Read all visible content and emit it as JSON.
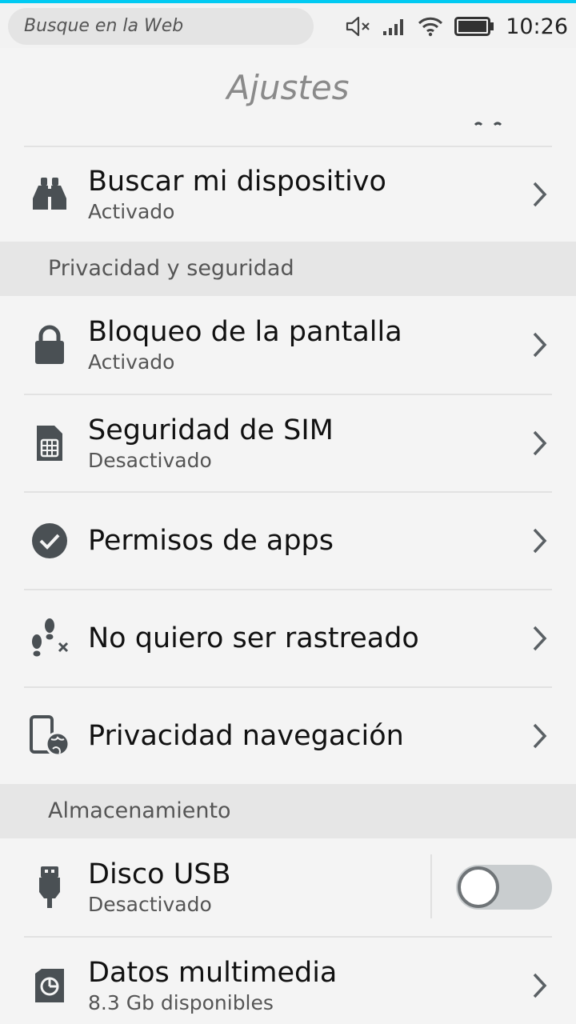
{
  "status_bar": {
    "search_placeholder": "Busque en la Web",
    "time": "10:26",
    "icons": [
      "mute-icon",
      "signal-icon",
      "wifi-icon",
      "battery-icon"
    ]
  },
  "header": {
    "title": "Ajustes"
  },
  "rows_top": [
    {
      "label": "Buscar mi dispositivo",
      "sub": "Activado",
      "icon": "binoculars-icon"
    }
  ],
  "sections": {
    "privacy": "Privacidad y seguridad",
    "storage": "Almacenamiento"
  },
  "privacy_rows": [
    {
      "label": "Bloqueo de la pantalla",
      "sub": "Activado",
      "icon": "lock-icon"
    },
    {
      "label": "Seguridad de SIM",
      "sub": "Desactivado",
      "icon": "sim-card-icon"
    },
    {
      "label": "Permisos de apps",
      "icon": "check-circle-icon"
    },
    {
      "label": "No quiero ser rastreado",
      "icon": "footprints-icon"
    },
    {
      "label": "Privacidad navegación",
      "icon": "device-globe-icon"
    }
  ],
  "storage_rows": [
    {
      "label": "Disco USB",
      "sub": "Desactivado",
      "icon": "usb-icon",
      "toggle_on": false
    },
    {
      "label": "Datos multimedia",
      "sub": "8.3 Gb disponibles",
      "icon": "media-storage-icon"
    }
  ],
  "colors": {
    "accent": "#00caf2",
    "icon": "#4a5054",
    "chevron": "#5a6064"
  }
}
